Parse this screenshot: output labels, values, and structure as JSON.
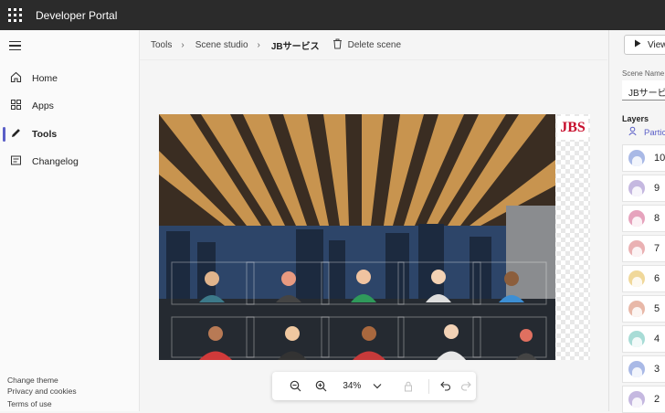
{
  "app": {
    "title": "Developer Portal"
  },
  "sidebar": {
    "items": [
      {
        "label": "Home",
        "icon": "home-icon",
        "active": false
      },
      {
        "label": "Apps",
        "icon": "apps-icon",
        "active": false
      },
      {
        "label": "Tools",
        "icon": "pencil-icon",
        "active": true
      },
      {
        "label": "Changelog",
        "icon": "changelog-icon",
        "active": false
      }
    ],
    "footer": [
      "Change theme",
      "Privacy and cookies",
      "Terms of use"
    ]
  },
  "breadcrumb": {
    "items": [
      "Tools",
      "Scene studio",
      "JBサービス"
    ],
    "delete_label": "Delete scene"
  },
  "scene": {
    "logo_text": "JBS"
  },
  "zoom": {
    "level": "34%"
  },
  "panel": {
    "view_label": "View",
    "scene_name_label": "Scene Name",
    "scene_name_value": "JBサービス",
    "layers_label": "Layers",
    "participants_label": "Participants",
    "layers": [
      {
        "number": "10",
        "color": "#a9b9e6"
      },
      {
        "number": "9",
        "color": "#c5b8e0"
      },
      {
        "number": "8",
        "color": "#e6a3bd"
      },
      {
        "number": "7",
        "color": "#eab1b3"
      },
      {
        "number": "6",
        "color": "#f0d89a"
      },
      {
        "number": "5",
        "color": "#e8b8a8"
      },
      {
        "number": "4",
        "color": "#a8dcd6"
      },
      {
        "number": "3",
        "color": "#a9b9e6"
      },
      {
        "number": "2",
        "color": "#c5b8e0"
      }
    ]
  }
}
